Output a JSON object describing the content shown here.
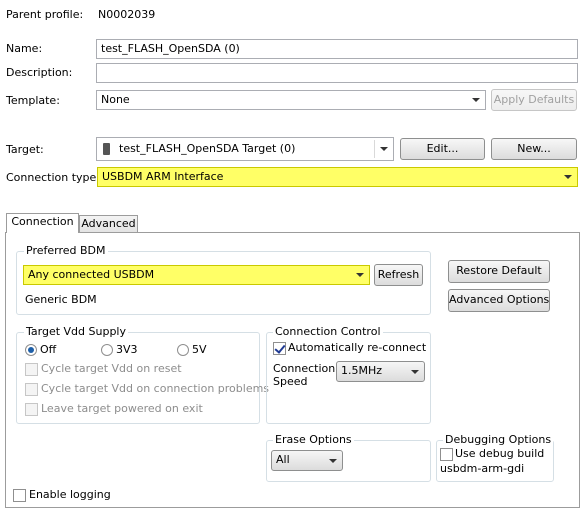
{
  "profile": {
    "parent_profile_label": "Parent profile:",
    "parent_profile_value": "N0002039",
    "name_label": "Name:",
    "name_value": "test_FLASH_OpenSDA (0)",
    "description_label": "Description:",
    "description_value": "",
    "template_label": "Template:",
    "template_value": "None",
    "apply_defaults_label": "Apply Defaults",
    "target_label": "Target:",
    "target_value": "test_FLASH_OpenSDA Target (0)",
    "edit_label": "Edit...",
    "new_label": "New...",
    "connection_type_label": "Connection type:",
    "connection_type_value": "USBDM ARM Interface"
  },
  "tabs": [
    {
      "label": "Connection",
      "active": true
    },
    {
      "label": "Advanced",
      "active": false
    }
  ],
  "connection": {
    "preferred_bdm_legend": "Preferred BDM",
    "preferred_bdm_value": "Any connected USBDM",
    "refresh_label": "Refresh",
    "bdm_description": "Generic BDM",
    "restore_default_label": "Restore Default",
    "advanced_options_label": "Advanced Options",
    "target_vdd_legend": "Target Vdd Supply",
    "vdd_options": [
      "Off",
      "3V3",
      "5V"
    ],
    "vdd_selected": "Off",
    "cycle_vdd_reset": "Cycle target Vdd on reset",
    "cycle_vdd_problems": "Cycle target Vdd on connection problems",
    "leave_powered": "Leave target powered on exit",
    "connection_control_legend": "Connection Control",
    "auto_reconnect_label": "Automatically re-connect",
    "auto_reconnect_checked": true,
    "connection_speed_label_1": "Connection",
    "connection_speed_label_2": "Speed",
    "connection_speed_value": "1.5MHz",
    "erase_options_legend": "Erase Options",
    "erase_value": "All",
    "debugging_options_legend": "Debugging Options",
    "use_debug_build_label": "Use debug build",
    "debug_build_name": "usbdm-arm-gdi",
    "enable_logging_label": "Enable logging"
  },
  "colors": {
    "highlight": "#ffff66",
    "group_border": "#d5dfe5"
  }
}
